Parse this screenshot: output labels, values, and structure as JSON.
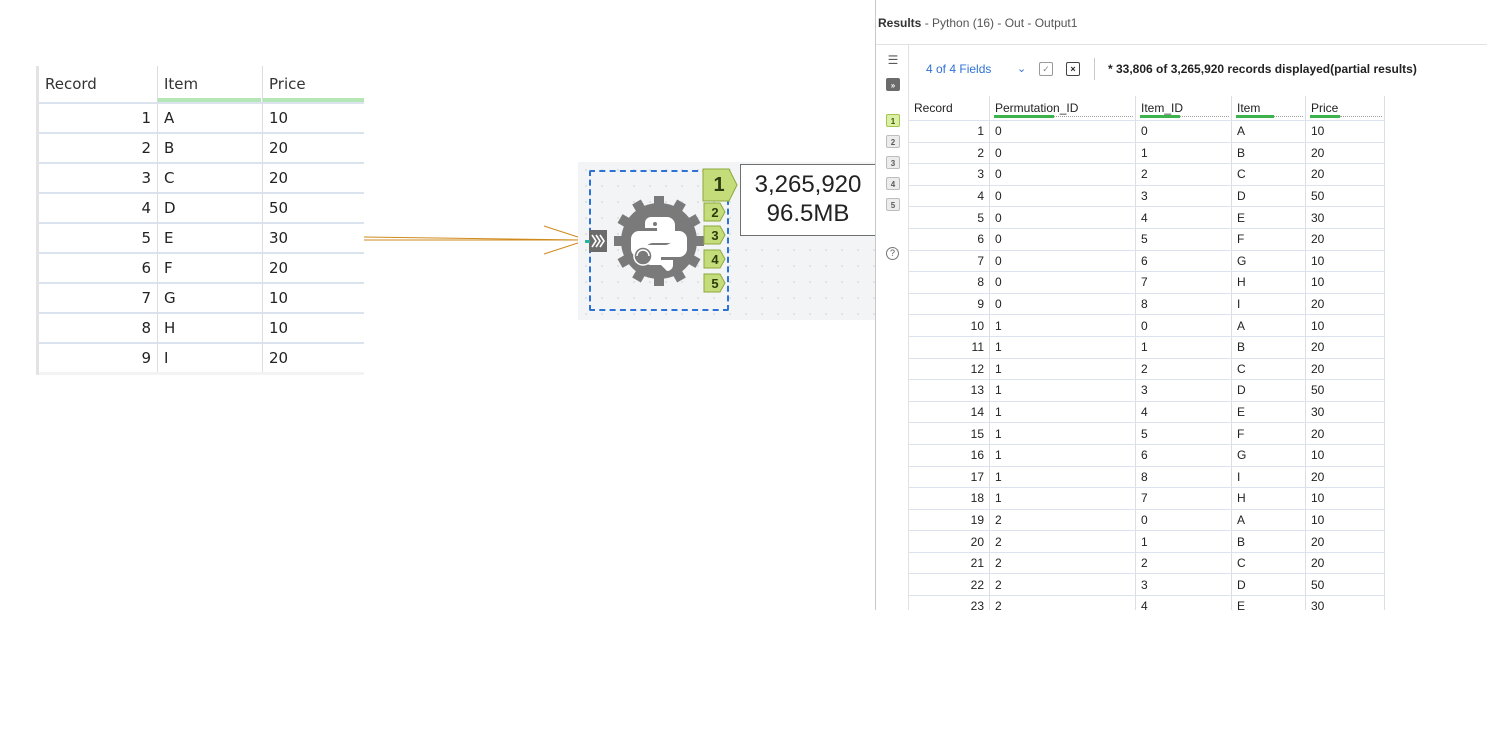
{
  "input_table": {
    "columns": [
      "Record",
      "Item",
      "Price"
    ],
    "rows": [
      [
        "1",
        "A",
        "10"
      ],
      [
        "2",
        "B",
        "20"
      ],
      [
        "3",
        "C",
        "20"
      ],
      [
        "4",
        "D",
        "50"
      ],
      [
        "5",
        "E",
        "30"
      ],
      [
        "6",
        "F",
        "20"
      ],
      [
        "7",
        "G",
        "10"
      ],
      [
        "8",
        "H",
        "10"
      ],
      [
        "9",
        "I",
        "20"
      ]
    ]
  },
  "tool": {
    "name_icon": "python-gear-icon",
    "input_anchor_icon": "input-anchor-chevrons-icon",
    "output_anchors": [
      "1",
      "2",
      "3",
      "4",
      "5"
    ],
    "stats": {
      "records": "3,265,920",
      "size": "96.5MB"
    },
    "colors": {
      "selection": "#2f72d6",
      "anchor": "#c5dc7a",
      "connector": "#d08a1c"
    }
  },
  "results": {
    "title_bold": "Results",
    "title_rest": " - Python (16) - Out - Output1",
    "fields_label": "4 of 4 Fields",
    "status": "* 33,806 of 3,265,920 records displayed(partial results)",
    "rail_anchors": [
      "1",
      "2",
      "3",
      "4",
      "5"
    ],
    "columns": [
      "Record",
      "Permutation_ID",
      "Item_ID",
      "Item",
      "Price"
    ],
    "rows": [
      [
        "1",
        "0",
        "0",
        "A",
        "10"
      ],
      [
        "2",
        "0",
        "1",
        "B",
        "20"
      ],
      [
        "3",
        "0",
        "2",
        "C",
        "20"
      ],
      [
        "4",
        "0",
        "3",
        "D",
        "50"
      ],
      [
        "5",
        "0",
        "4",
        "E",
        "30"
      ],
      [
        "6",
        "0",
        "5",
        "F",
        "20"
      ],
      [
        "7",
        "0",
        "6",
        "G",
        "10"
      ],
      [
        "8",
        "0",
        "7",
        "H",
        "10"
      ],
      [
        "9",
        "0",
        "8",
        "I",
        "20"
      ],
      [
        "10",
        "1",
        "0",
        "A",
        "10"
      ],
      [
        "11",
        "1",
        "1",
        "B",
        "20"
      ],
      [
        "12",
        "1",
        "2",
        "C",
        "20"
      ],
      [
        "13",
        "1",
        "3",
        "D",
        "50"
      ],
      [
        "14",
        "1",
        "4",
        "E",
        "30"
      ],
      [
        "15",
        "1",
        "5",
        "F",
        "20"
      ],
      [
        "16",
        "1",
        "6",
        "G",
        "10"
      ],
      [
        "17",
        "1",
        "8",
        "I",
        "20"
      ],
      [
        "18",
        "1",
        "7",
        "H",
        "10"
      ],
      [
        "19",
        "2",
        "0",
        "A",
        "10"
      ],
      [
        "20",
        "2",
        "1",
        "B",
        "20"
      ],
      [
        "21",
        "2",
        "2",
        "C",
        "20"
      ],
      [
        "22",
        "2",
        "3",
        "D",
        "50"
      ],
      [
        "23",
        "2",
        "4",
        "E",
        "30"
      ]
    ]
  }
}
